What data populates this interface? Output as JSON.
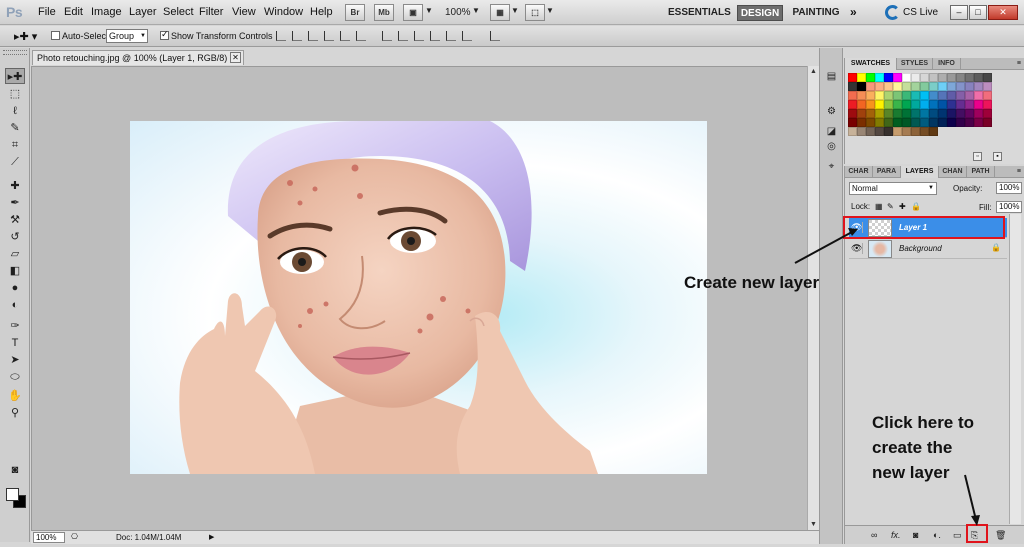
{
  "app": {
    "logo": "Ps",
    "menus": [
      "File",
      "Edit",
      "Image",
      "Layer",
      "Select",
      "Filter",
      "View",
      "Window",
      "Help"
    ],
    "bridge_label": "Br",
    "minibridge_label": "Mb",
    "zoom": "100%",
    "workspaces": [
      "ESSENTIALS",
      "DESIGN",
      "PAINTING"
    ],
    "more_workspaces": "»",
    "cs_live": "CS Live",
    "window_controls": [
      "–",
      "□",
      "✕"
    ]
  },
  "options_bar": {
    "auto_select_label": "Auto-Select:",
    "auto_select_value": "Group",
    "show_transform_label": "Show Transform Controls"
  },
  "document": {
    "tab_title": "Photo retouching.jpg @ 100% (Layer 1, RGB/8) *",
    "tab_close": "✕",
    "status_zoom": "100%",
    "doc_info": "Doc: 1.04M/1.04M"
  },
  "swatches_panel": {
    "tabs": [
      "SWATCHES",
      "STYLES",
      "INFO"
    ],
    "active_tab": "SWATCHES",
    "colors": [
      "#ff0000",
      "#ffff00",
      "#00ff00",
      "#00ffff",
      "#0000ff",
      "#ff00ff",
      "#ffffff",
      "#ebebeb",
      "#d6d6d6",
      "#c2c2c2",
      "#adadad",
      "#999999",
      "#858585",
      "#707070",
      "#5c5c5c",
      "#474747",
      "#333333",
      "#000000",
      "#f7977a",
      "#fbad82",
      "#fdc68c",
      "#fff79a",
      "#c4df9b",
      "#a3d39c",
      "#82ca9d",
      "#7bcdc8",
      "#6ecff6",
      "#7ea7d8",
      "#8493ca",
      "#8882be",
      "#a187be",
      "#bc8dbf",
      "#f26c4f",
      "#f68e56",
      "#fbaf5d",
      "#fff467",
      "#acd372",
      "#7cc576",
      "#3bb878",
      "#1abbb4",
      "#00bff3",
      "#438ccb",
      "#5574b9",
      "#605ca8",
      "#855fa8",
      "#a763a8",
      "#f06ea9",
      "#f26d7d",
      "#ed1c24",
      "#f26522",
      "#f7941d",
      "#fff200",
      "#8dc63f",
      "#39b54a",
      "#00a651",
      "#00a99d",
      "#00aeef",
      "#0072bc",
      "#0054a6",
      "#2e3192",
      "#662d91",
      "#92278f",
      "#ec008c",
      "#ed145b",
      "#9e0b0f",
      "#a0410d",
      "#a36209",
      "#aba000",
      "#598527",
      "#197b30",
      "#007236",
      "#00746b",
      "#0076a3",
      "#004b80",
      "#003471",
      "#1b1464",
      "#440e62",
      "#630460",
      "#9e005d",
      "#9e0039",
      "#790000",
      "#7b2e00",
      "#7d4900",
      "#827b00",
      "#406618",
      "#005e20",
      "#005826",
      "#005952",
      "#005b7f",
      "#003663",
      "#002157",
      "#0d004c",
      "#32004b",
      "#4b0049",
      "#7b0046",
      "#7a0026",
      "#c7b299",
      "#998675",
      "#736357",
      "#534741",
      "#37302d",
      "#c69c6d",
      "#a67c52",
      "#8c6239",
      "#754c24",
      "#603913"
    ]
  },
  "layers_panel": {
    "tabs": [
      "CHAR",
      "PARA",
      "LAYERS",
      "CHAN",
      "PATH"
    ],
    "active_tab": "LAYERS",
    "blend_mode": "Normal",
    "opacity_label": "Opacity:",
    "opacity_value": "100%",
    "lock_label": "Lock:",
    "fill_label": "Fill:",
    "fill_value": "100%",
    "layers": [
      {
        "name": "Layer 1",
        "selected": true
      },
      {
        "name": "Background",
        "selected": false,
        "locked": true
      }
    ]
  },
  "annotations": {
    "create_new_layer": "Create new layer",
    "click_here": [
      "Click here to",
      "create the",
      "new layer"
    ]
  }
}
